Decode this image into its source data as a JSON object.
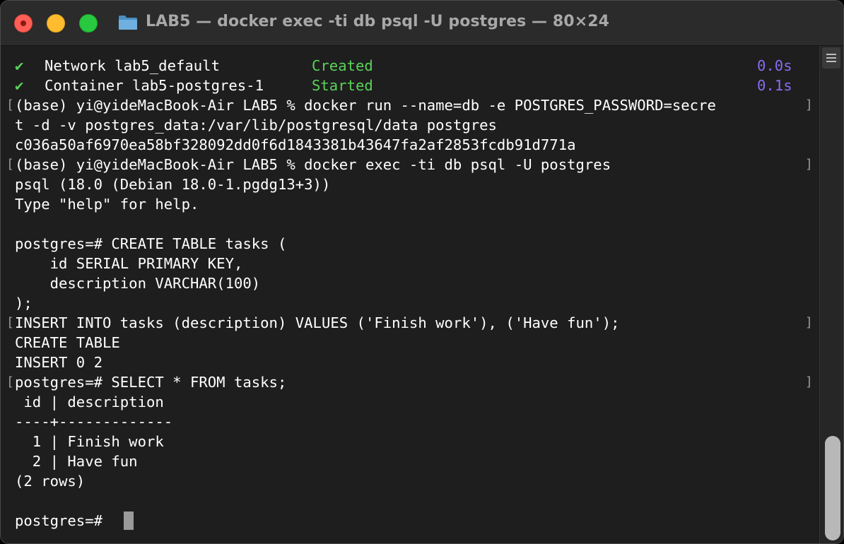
{
  "window": {
    "title": "LAB5 — docker exec -ti db psql -U postgres — 80×24"
  },
  "colors": {
    "success_green": "#5ad15a",
    "timing_purple": "#8b6cf0",
    "text": "#ffffff",
    "background": "#1e1e1e"
  },
  "icons": {
    "close": "close-button",
    "minimize": "minimize-button",
    "zoom": "zoom-button",
    "folder": "folder-icon",
    "check": "checkmark-icon"
  },
  "terminal": {
    "status_rows": [
      {
        "check": "✔",
        "resource": "Network lab5_default",
        "state": "Created",
        "time": "0.0s"
      },
      {
        "check": "✔",
        "resource": "Container lab5-postgres-1",
        "state": "Started",
        "time": "0.1s"
      }
    ],
    "lines": [
      "(base) yi@yideMacBook-Air LAB5 % docker run --name=db -e POSTGRES_PASSWORD=secre",
      "t -d -v postgres_data:/var/lib/postgresql/data postgres",
      "c036a50af6970ea58bf328092dd0f6d1843381b43647fa2af2853fcdb91d771a",
      "(base) yi@yideMacBook-Air LAB5 % docker exec -ti db psql -U postgres",
      "psql (18.0 (Debian 18.0-1.pgdg13+3))",
      "Type \"help\" for help.",
      "",
      "postgres=# CREATE TABLE tasks (",
      "    id SERIAL PRIMARY KEY,",
      "    description VARCHAR(100)",
      ");",
      "INSERT INTO tasks (description) VALUES ('Finish work'), ('Have fun');",
      "CREATE TABLE",
      "INSERT 0 2",
      "postgres=# SELECT * FROM tasks;",
      " id | description",
      "----+-------------",
      "  1 | Finish work",
      "  2 | Have fun",
      "(2 rows)",
      "",
      "postgres=# "
    ]
  }
}
